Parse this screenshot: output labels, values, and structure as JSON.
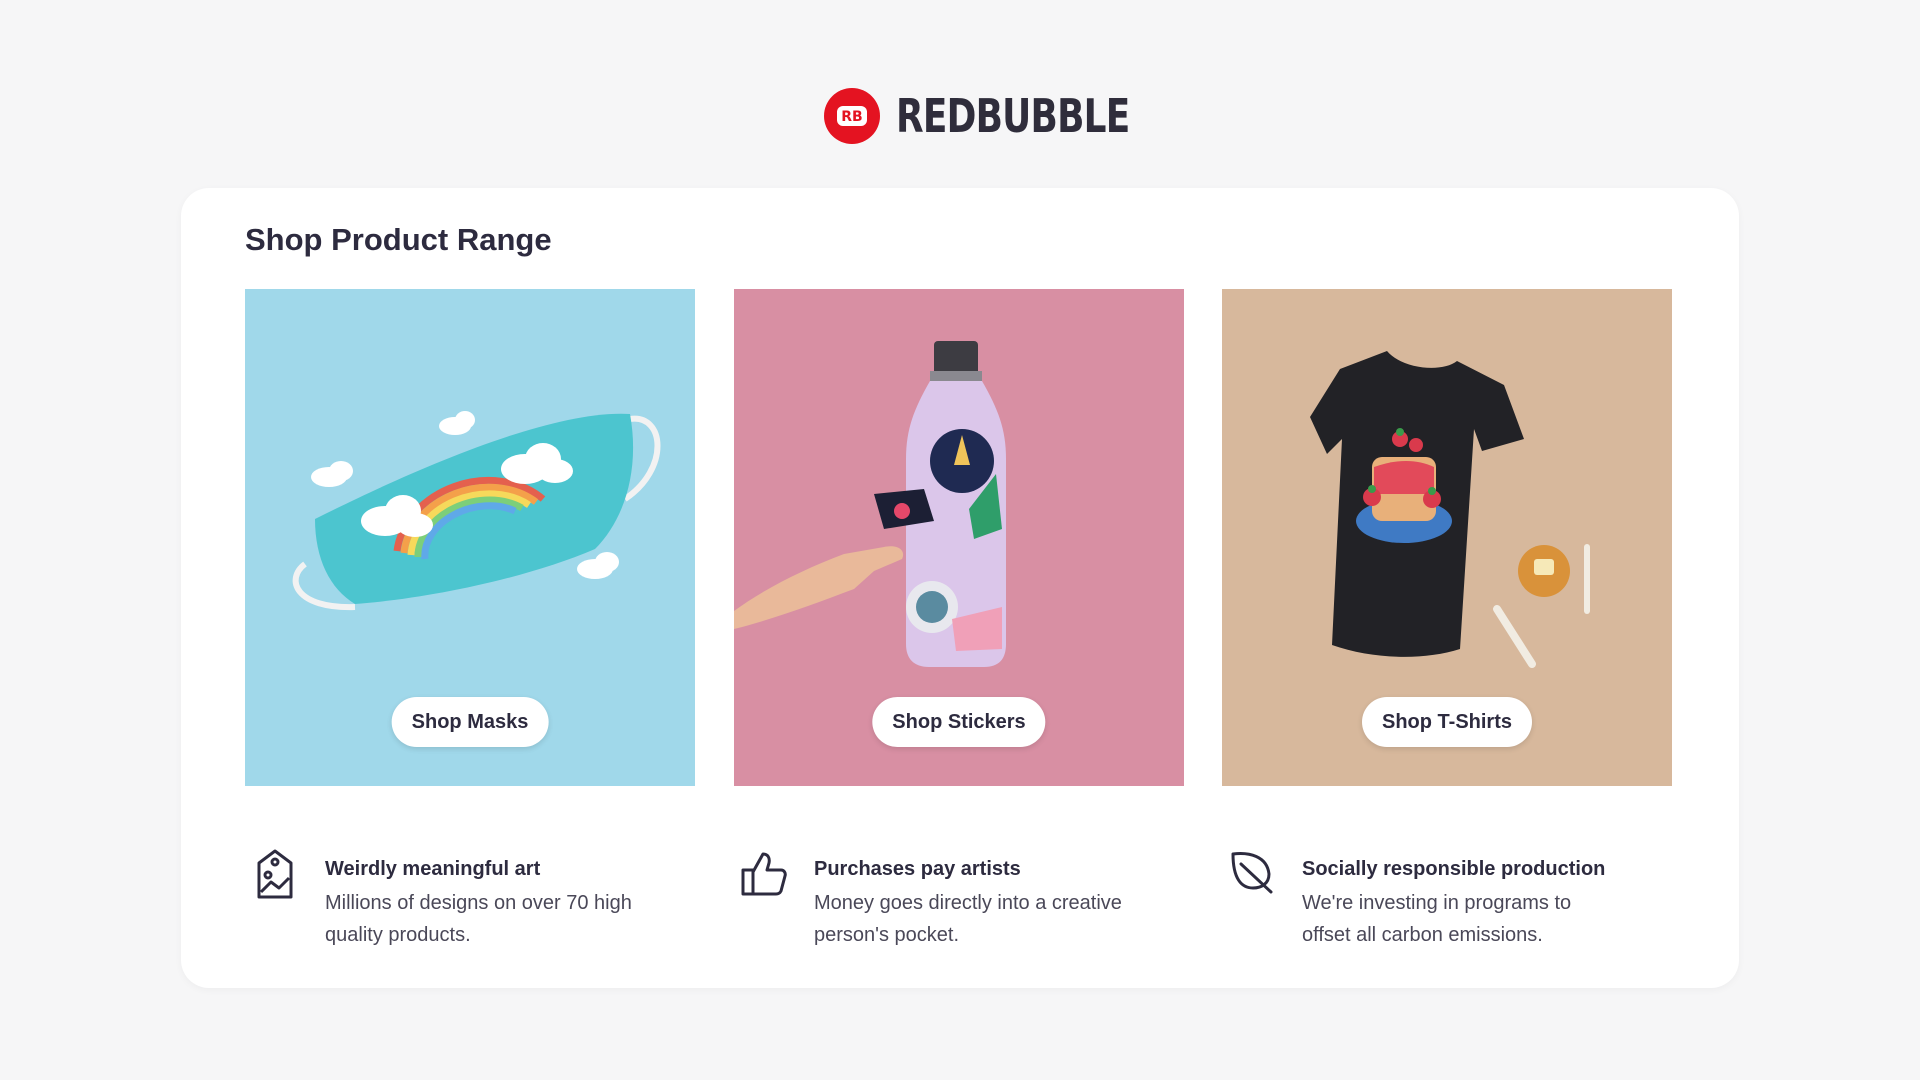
{
  "brand": {
    "name": "REDBUBBLE",
    "mark_text": "RB",
    "color": "#e41321"
  },
  "section": {
    "title": "Shop Product Range"
  },
  "tiles": [
    {
      "button_label": "Shop Masks",
      "background": "#a0d8ea",
      "image": "face-mask-rainbow"
    },
    {
      "button_label": "Shop Stickers",
      "background": "#d88fa3",
      "image": "water-bottle-stickers"
    },
    {
      "button_label": "Shop T-Shirts",
      "background": "#d7b89c",
      "image": "black-tshirt-pancakes"
    }
  ],
  "features": [
    {
      "icon": "art-tag-icon",
      "title": "Weirdly meaningful art",
      "description": "Millions of designs on over 70 high quality products."
    },
    {
      "icon": "thumbs-up-icon",
      "title": "Purchases pay artists",
      "description": "Money goes directly into a creative person's pocket."
    },
    {
      "icon": "leaf-icon",
      "title": "Socially responsible production",
      "description": "We're investing in programs to offset all carbon emissions."
    }
  ]
}
